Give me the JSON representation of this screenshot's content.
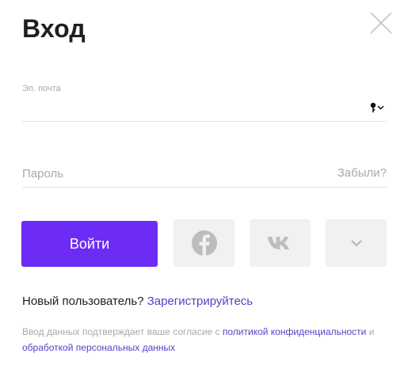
{
  "dialog": {
    "title": "Вход",
    "close_icon": "close-icon"
  },
  "email": {
    "label": "Эл. почта",
    "value": "",
    "dropdown_icon": "key-icon"
  },
  "password": {
    "placeholder": "Пароль",
    "value": "",
    "forgot_label": "Забыли?"
  },
  "actions": {
    "login_label": "Войти",
    "social": [
      {
        "name": "facebook",
        "icon": "facebook-icon"
      },
      {
        "name": "vk",
        "icon": "vk-icon"
      },
      {
        "name": "more",
        "icon": "chevron-down-icon"
      }
    ]
  },
  "register": {
    "prompt": "Новый пользователь?",
    "link_label": "Зарегистрируйтесь"
  },
  "consent": {
    "text": "Ввод данных подтверждает ваше согласие с",
    "policy_link": "политикой конфиденциальности",
    "conjunction": "и",
    "processing_link": "обработкой персональных данных"
  },
  "colors": {
    "accent": "#6c2cf5",
    "link": "#5a3ec8",
    "muted": "#a8a8a8",
    "social_bg": "#f1f1f4"
  }
}
